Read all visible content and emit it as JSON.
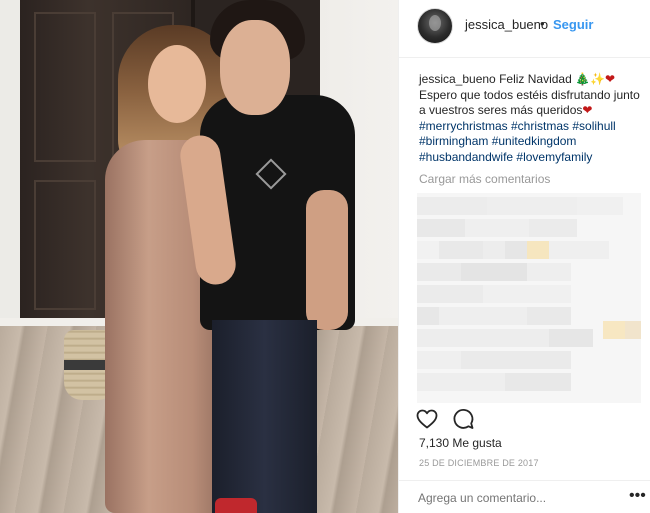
{
  "post": {
    "author": {
      "username": "jessica_bueno",
      "separator": "•",
      "follow_label": "Seguir"
    },
    "caption": {
      "username": "jessica_bueno",
      "line1": " Feliz Navidad ",
      "emoji_tree": "🎄",
      "emoji_sparkle": "✨",
      "emoji_heart": "❤",
      "line2": "Espero que todos estéis disfrutando junto a vuestros seres más queridos",
      "emoji_heart2": "❤",
      "hashtags": "#merrychristmas #christmas #solihull #birmingham #unitedkingdom #husbandandwife #lovemyfamily"
    },
    "load_more_label": "Cargar más comentarios",
    "actions": {
      "like_icon": "heart-outline-icon",
      "comment_icon": "comment-bubble-icon"
    },
    "likes_text": "7,130 Me gusta",
    "date_text": "25 DE DICIEMBRE DE 2017",
    "comment_placeholder": "Agrega un comentario...",
    "more_icon": "more-options-icon",
    "colors": {
      "link": "#3897f0",
      "hashtag": "#003569",
      "muted": "#999999",
      "text": "#262626"
    }
  }
}
